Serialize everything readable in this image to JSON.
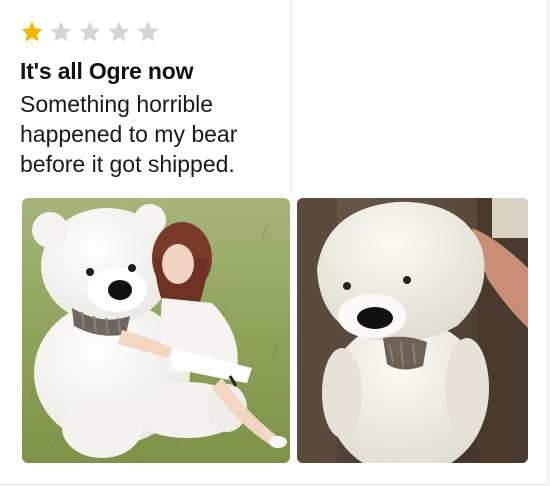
{
  "review": {
    "rating": 1,
    "max_rating": 5,
    "star_filled_color": "#f5b400",
    "star_empty_color": "#d6d6d6",
    "title": "It's all Ogre now",
    "body_lines": [
      "Something horrible",
      "happened to my bear",
      "before it got shipped."
    ]
  },
  "photos": [
    {
      "icon": "product-photo-girl-with-teddy-bear"
    },
    {
      "icon": "customer-photo-deformed-teddy-bear"
    }
  ]
}
